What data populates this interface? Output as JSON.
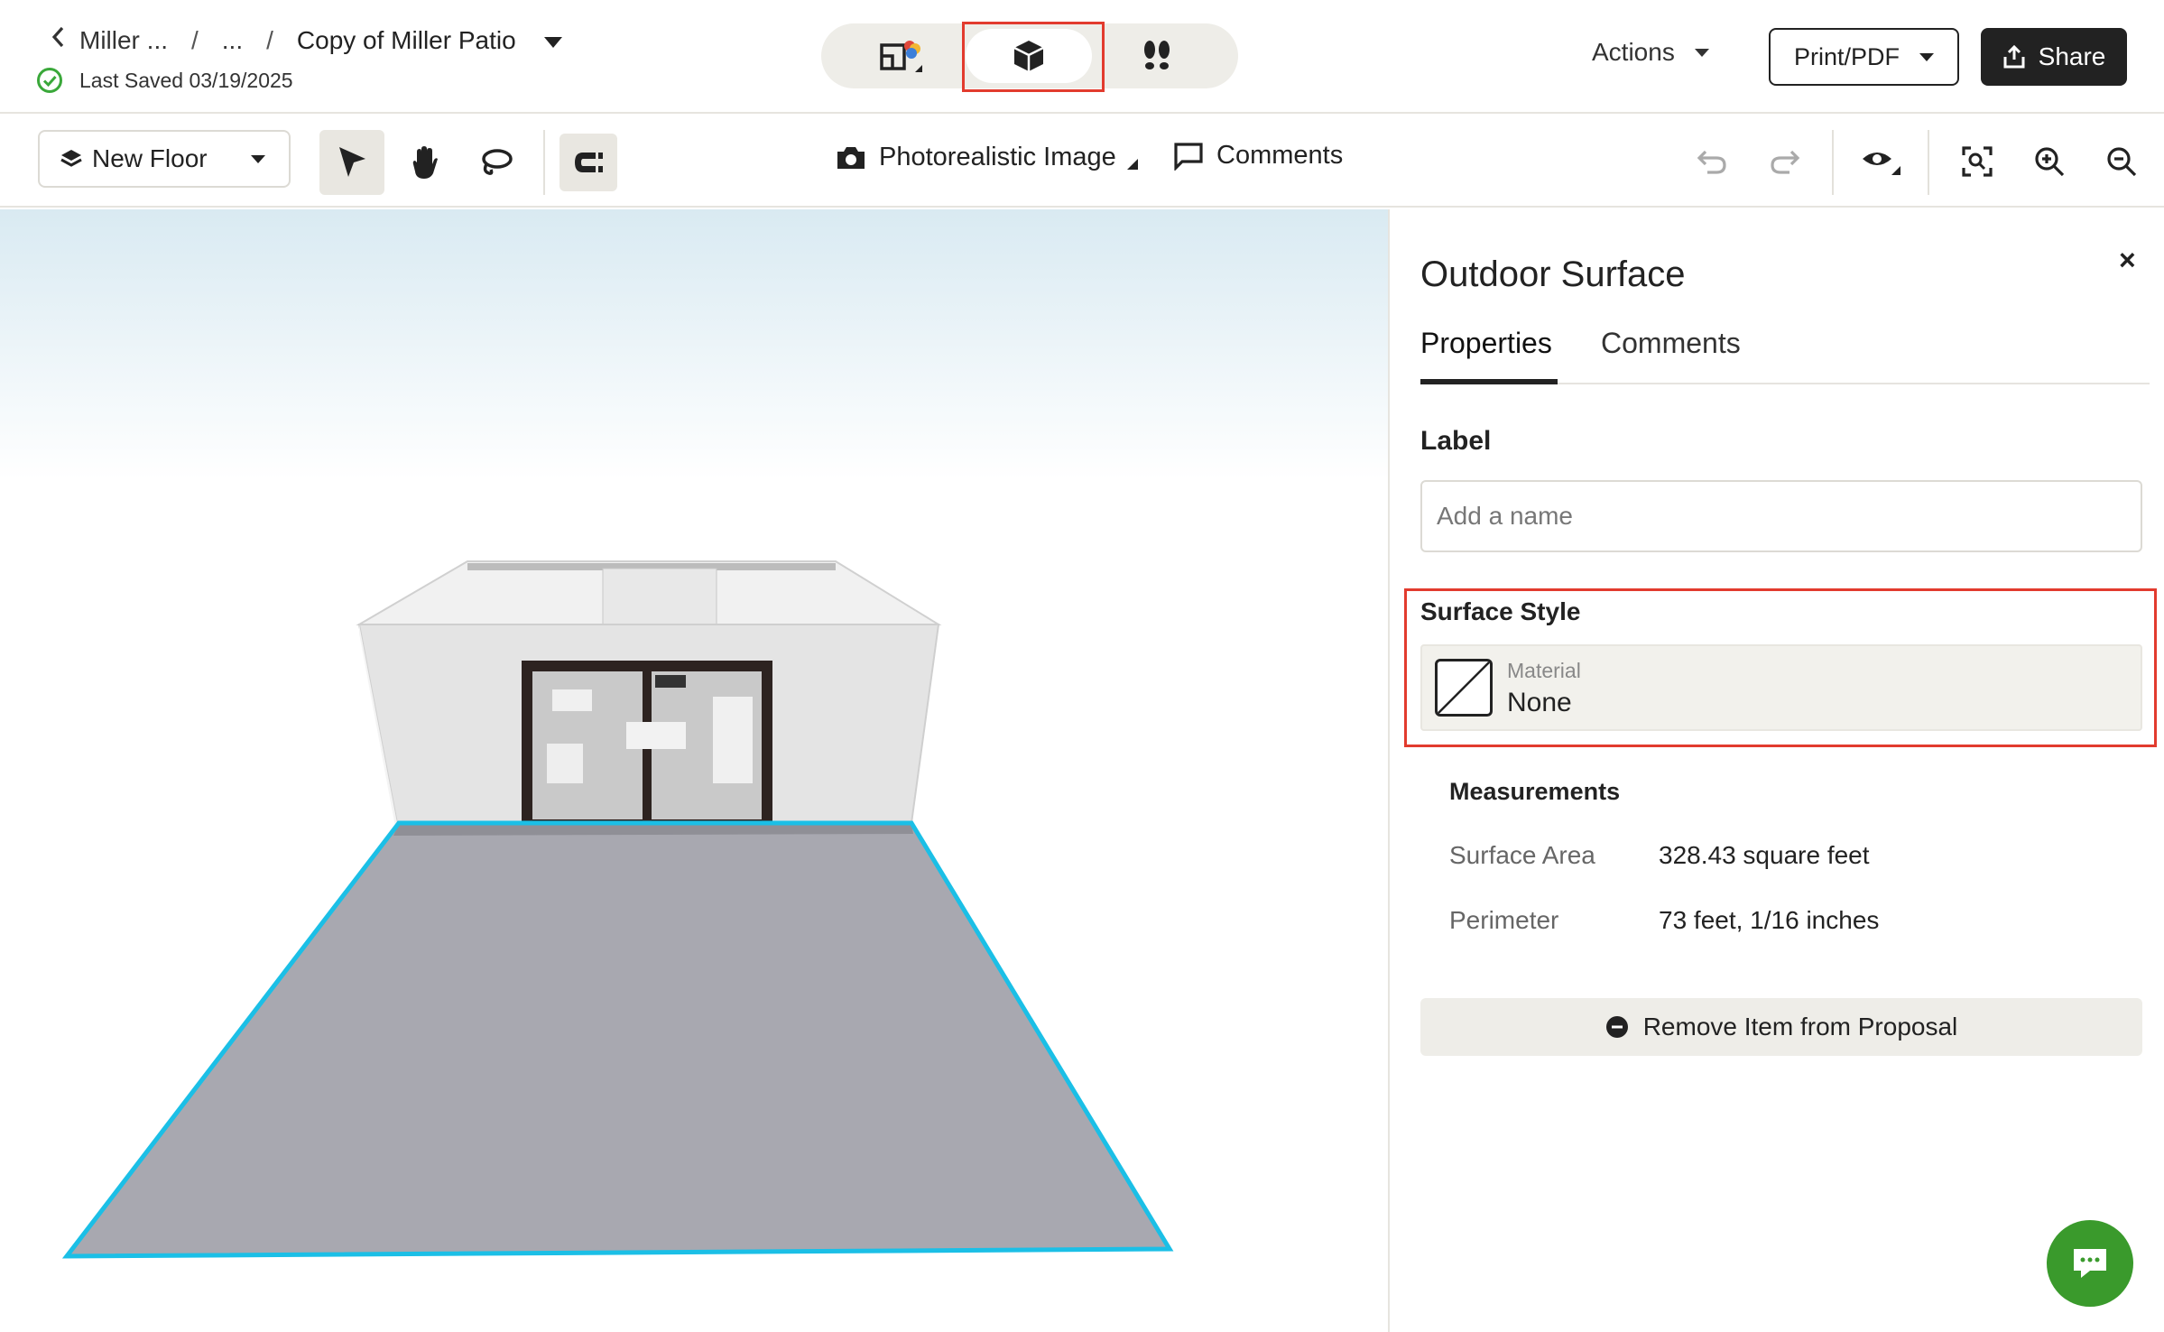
{
  "header": {
    "breadcrumb": [
      "Miller ...",
      "...",
      "Copy of Miller Patio"
    ],
    "separators": [
      "/",
      "/"
    ],
    "saved_text": "Last Saved 03/19/2025",
    "actions_label": "Actions",
    "print_label": "Print/PDF",
    "share_label": "Share",
    "view_modes": [
      "floor-plan-icon",
      "3d-box-icon",
      "walkthrough-footsteps-icon"
    ],
    "active_view": "3d-box-icon"
  },
  "toolbar": {
    "floor_label": "New Floor",
    "photo_label": "Photorealistic Image",
    "comments_label": "Comments"
  },
  "panel": {
    "title": "Outdoor Surface",
    "close_label": "×",
    "tabs": [
      "Properties",
      "Comments"
    ],
    "active_tab": "Properties",
    "label_heading": "Label",
    "label_placeholder": "Add a name",
    "surface_style_heading": "Surface Style",
    "material_label": "Material",
    "material_value": "None",
    "measurements_heading": "Measurements",
    "measurements": [
      {
        "key": "Surface Area",
        "value": "328.43 square feet"
      },
      {
        "key": "Perimeter",
        "value": "73 feet, 1/16 inches"
      }
    ],
    "remove_label": "Remove Item from Proposal"
  },
  "colors": {
    "highlight": "#e23b2e",
    "selection_outline": "#1bbfe6",
    "chat_green": "#3a9a2c",
    "saved_check": "#3aa83a"
  }
}
